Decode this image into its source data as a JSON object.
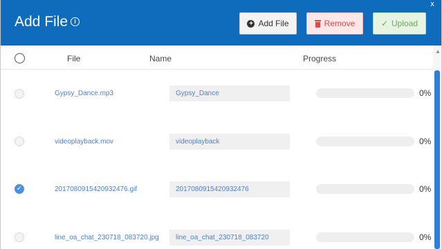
{
  "header": {
    "title": "Add File",
    "info_glyph": "i",
    "close_glyph": "x",
    "buttons": {
      "add_label": "Add File",
      "remove_label": "Remove",
      "upload_label": "Upload"
    }
  },
  "table": {
    "columns": {
      "file": "File",
      "name": "Name",
      "progress": "Progress"
    },
    "rows": [
      {
        "file": "Gypsy_Dance.mp3",
        "name": "Gypsy_Dance",
        "progress": 0,
        "progress_label": "0%",
        "checked": false
      },
      {
        "file": "videoplayback.mov",
        "name": "videoplayback",
        "progress": 0,
        "progress_label": "0%",
        "checked": false
      },
      {
        "file": "2017080915420932476.gif",
        "name": "2017080915420932476",
        "progress": 0,
        "progress_label": "0%",
        "checked": true
      },
      {
        "file": "line_oa_chat_230718_083720.jpg",
        "name": "line_oa_chat_230718_083720",
        "progress": 0,
        "progress_label": "0%",
        "checked": false
      }
    ]
  },
  "colors": {
    "header_bg": "#0f6cbd",
    "link": "#4a7fd0",
    "checked": "#4a90e2",
    "remove": "#e04a4a",
    "upload": "#6aa95a"
  },
  "icons": {
    "info": "info-icon",
    "add": "plus-circle-icon",
    "remove": "trash-icon",
    "upload": "check-icon",
    "close": "close-icon"
  }
}
